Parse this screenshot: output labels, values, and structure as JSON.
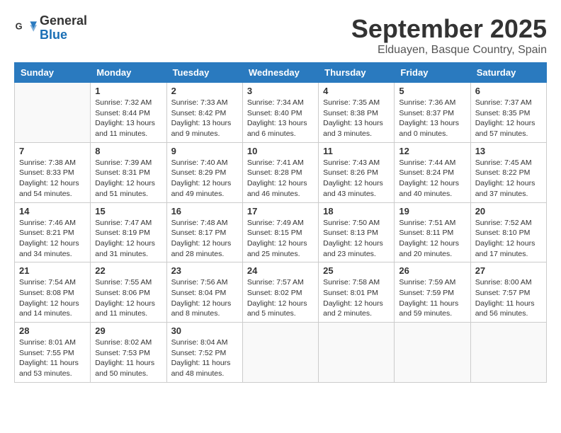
{
  "logo": {
    "general": "General",
    "blue": "Blue"
  },
  "title": "September 2025",
  "subtitle": "Elduayen, Basque Country, Spain",
  "weekdays": [
    "Sunday",
    "Monday",
    "Tuesday",
    "Wednesday",
    "Thursday",
    "Friday",
    "Saturday"
  ],
  "weeks": [
    [
      {
        "day": "",
        "info": ""
      },
      {
        "day": "1",
        "info": "Sunrise: 7:32 AM\nSunset: 8:44 PM\nDaylight: 13 hours\nand 11 minutes."
      },
      {
        "day": "2",
        "info": "Sunrise: 7:33 AM\nSunset: 8:42 PM\nDaylight: 13 hours\nand 9 minutes."
      },
      {
        "day": "3",
        "info": "Sunrise: 7:34 AM\nSunset: 8:40 PM\nDaylight: 13 hours\nand 6 minutes."
      },
      {
        "day": "4",
        "info": "Sunrise: 7:35 AM\nSunset: 8:38 PM\nDaylight: 13 hours\nand 3 minutes."
      },
      {
        "day": "5",
        "info": "Sunrise: 7:36 AM\nSunset: 8:37 PM\nDaylight: 13 hours\nand 0 minutes."
      },
      {
        "day": "6",
        "info": "Sunrise: 7:37 AM\nSunset: 8:35 PM\nDaylight: 12 hours\nand 57 minutes."
      }
    ],
    [
      {
        "day": "7",
        "info": "Sunrise: 7:38 AM\nSunset: 8:33 PM\nDaylight: 12 hours\nand 54 minutes."
      },
      {
        "day": "8",
        "info": "Sunrise: 7:39 AM\nSunset: 8:31 PM\nDaylight: 12 hours\nand 51 minutes."
      },
      {
        "day": "9",
        "info": "Sunrise: 7:40 AM\nSunset: 8:29 PM\nDaylight: 12 hours\nand 49 minutes."
      },
      {
        "day": "10",
        "info": "Sunrise: 7:41 AM\nSunset: 8:28 PM\nDaylight: 12 hours\nand 46 minutes."
      },
      {
        "day": "11",
        "info": "Sunrise: 7:43 AM\nSunset: 8:26 PM\nDaylight: 12 hours\nand 43 minutes."
      },
      {
        "day": "12",
        "info": "Sunrise: 7:44 AM\nSunset: 8:24 PM\nDaylight: 12 hours\nand 40 minutes."
      },
      {
        "day": "13",
        "info": "Sunrise: 7:45 AM\nSunset: 8:22 PM\nDaylight: 12 hours\nand 37 minutes."
      }
    ],
    [
      {
        "day": "14",
        "info": "Sunrise: 7:46 AM\nSunset: 8:21 PM\nDaylight: 12 hours\nand 34 minutes."
      },
      {
        "day": "15",
        "info": "Sunrise: 7:47 AM\nSunset: 8:19 PM\nDaylight: 12 hours\nand 31 minutes."
      },
      {
        "day": "16",
        "info": "Sunrise: 7:48 AM\nSunset: 8:17 PM\nDaylight: 12 hours\nand 28 minutes."
      },
      {
        "day": "17",
        "info": "Sunrise: 7:49 AM\nSunset: 8:15 PM\nDaylight: 12 hours\nand 25 minutes."
      },
      {
        "day": "18",
        "info": "Sunrise: 7:50 AM\nSunset: 8:13 PM\nDaylight: 12 hours\nand 23 minutes."
      },
      {
        "day": "19",
        "info": "Sunrise: 7:51 AM\nSunset: 8:11 PM\nDaylight: 12 hours\nand 20 minutes."
      },
      {
        "day": "20",
        "info": "Sunrise: 7:52 AM\nSunset: 8:10 PM\nDaylight: 12 hours\nand 17 minutes."
      }
    ],
    [
      {
        "day": "21",
        "info": "Sunrise: 7:54 AM\nSunset: 8:08 PM\nDaylight: 12 hours\nand 14 minutes."
      },
      {
        "day": "22",
        "info": "Sunrise: 7:55 AM\nSunset: 8:06 PM\nDaylight: 12 hours\nand 11 minutes."
      },
      {
        "day": "23",
        "info": "Sunrise: 7:56 AM\nSunset: 8:04 PM\nDaylight: 12 hours\nand 8 minutes."
      },
      {
        "day": "24",
        "info": "Sunrise: 7:57 AM\nSunset: 8:02 PM\nDaylight: 12 hours\nand 5 minutes."
      },
      {
        "day": "25",
        "info": "Sunrise: 7:58 AM\nSunset: 8:01 PM\nDaylight: 12 hours\nand 2 minutes."
      },
      {
        "day": "26",
        "info": "Sunrise: 7:59 AM\nSunset: 7:59 PM\nDaylight: 11 hours\nand 59 minutes."
      },
      {
        "day": "27",
        "info": "Sunrise: 8:00 AM\nSunset: 7:57 PM\nDaylight: 11 hours\nand 56 minutes."
      }
    ],
    [
      {
        "day": "28",
        "info": "Sunrise: 8:01 AM\nSunset: 7:55 PM\nDaylight: 11 hours\nand 53 minutes."
      },
      {
        "day": "29",
        "info": "Sunrise: 8:02 AM\nSunset: 7:53 PM\nDaylight: 11 hours\nand 50 minutes."
      },
      {
        "day": "30",
        "info": "Sunrise: 8:04 AM\nSunset: 7:52 PM\nDaylight: 11 hours\nand 48 minutes."
      },
      {
        "day": "",
        "info": ""
      },
      {
        "day": "",
        "info": ""
      },
      {
        "day": "",
        "info": ""
      },
      {
        "day": "",
        "info": ""
      }
    ]
  ]
}
